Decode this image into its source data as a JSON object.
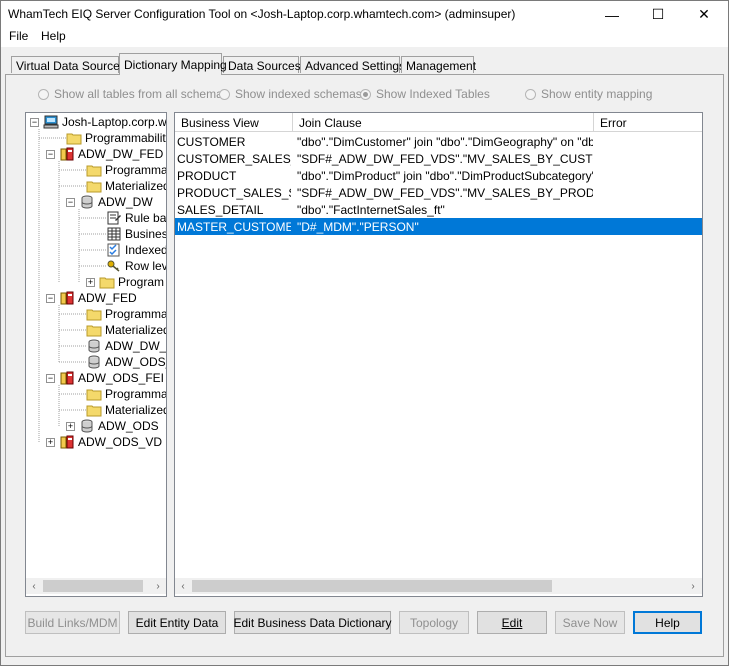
{
  "window": {
    "title": "WhamTech EIQ Server Configuration Tool on <Josh-Laptop.corp.whamtech.com> (adminsuper)",
    "min_glyph": "—",
    "max_glyph": "☐",
    "close_glyph": "✕"
  },
  "menu": {
    "file": "File",
    "help": "Help"
  },
  "tabs": [
    "Virtual Data Sources",
    "Dictionary Mapping",
    "Data Sources",
    "Advanced Settings",
    "Management"
  ],
  "options": {
    "all_tables": "Show all tables from all schemas",
    "indexed_schemas": "Show indexed schemas",
    "indexed_tables": "Show Indexed Tables",
    "entity_mapping": "Show entity mapping"
  },
  "tree": {
    "nodes": [
      {
        "label": "Josh-Laptop.corp.wh",
        "icon": "computer-icon"
      },
      {
        "label": "Programmability",
        "icon": "folder-icon"
      },
      {
        "label": "ADW_DW_FED",
        "icon": "database-federated-icon"
      },
      {
        "label": "Programmab",
        "icon": "folder-icon"
      },
      {
        "label": "Materialized",
        "icon": "folder-icon"
      },
      {
        "label": "ADW_DW",
        "icon": "database-icon"
      },
      {
        "label": "Rule ba",
        "icon": "rule-icon"
      },
      {
        "label": "Busines",
        "icon": "table-icon"
      },
      {
        "label": "Indexed",
        "icon": "index-icon"
      },
      {
        "label": "Row lev",
        "icon": "key-icon"
      },
      {
        "label": "Program",
        "icon": "folder-icon"
      },
      {
        "label": "ADW_FED",
        "icon": "database-federated-icon"
      },
      {
        "label": "Programmab",
        "icon": "folder-icon"
      },
      {
        "label": "Materialized",
        "icon": "folder-icon"
      },
      {
        "label": "ADW_DW_",
        "icon": "database-icon"
      },
      {
        "label": "ADW_ODS_",
        "icon": "database-icon"
      },
      {
        "label": "ADW_ODS_FEI",
        "icon": "database-federated-icon"
      },
      {
        "label": "Programmab",
        "icon": "folder-icon"
      },
      {
        "label": "Materialized",
        "icon": "folder-icon"
      },
      {
        "label": "ADW_ODS",
        "icon": "database-icon"
      },
      {
        "label": "ADW_ODS_VD",
        "icon": "database-federated-icon"
      }
    ]
  },
  "grid": {
    "columns": [
      "Business View",
      "Join Clause",
      "Error"
    ],
    "rows": [
      {
        "view": "CUSTOMER",
        "join": "\"dbo\".\"DimCustomer\" join \"dbo\".\"DimGeography\" on \"dbo\"....",
        "error": ""
      },
      {
        "view": "CUSTOMER_SALES_...",
        "join": "\"SDF#_ADW_DW_FED_VDS\".\"MV_SALES_BY_CUSTOM...",
        "error": ""
      },
      {
        "view": "PRODUCT",
        "join": "\"dbo\".\"DimProduct\" join \"dbo\".\"DimProductSubcategory\" O...",
        "error": ""
      },
      {
        "view": "PRODUCT_SALES_S...",
        "join": "\"SDF#_ADW_DW_FED_VDS\".\"MV_SALES_BY_PRODUC...",
        "error": ""
      },
      {
        "view": "SALES_DETAIL",
        "join": "\"dbo\".\"FactInternetSales_ft\"",
        "error": ""
      },
      {
        "view": "MASTER_CUSTOMER",
        "join": "\"D#_MDM\".\"PERSON\"",
        "error": ""
      }
    ]
  },
  "buttons": {
    "build_links": "Build Links/MDM",
    "edit_entity": "Edit Entity Data",
    "edit_bdd": "Edit Business Data Dictionary",
    "topology": "Topology",
    "edit": "Edit",
    "save_now": "Save Now",
    "help": "Help"
  },
  "scroll": {
    "left": "‹",
    "right": "›"
  }
}
